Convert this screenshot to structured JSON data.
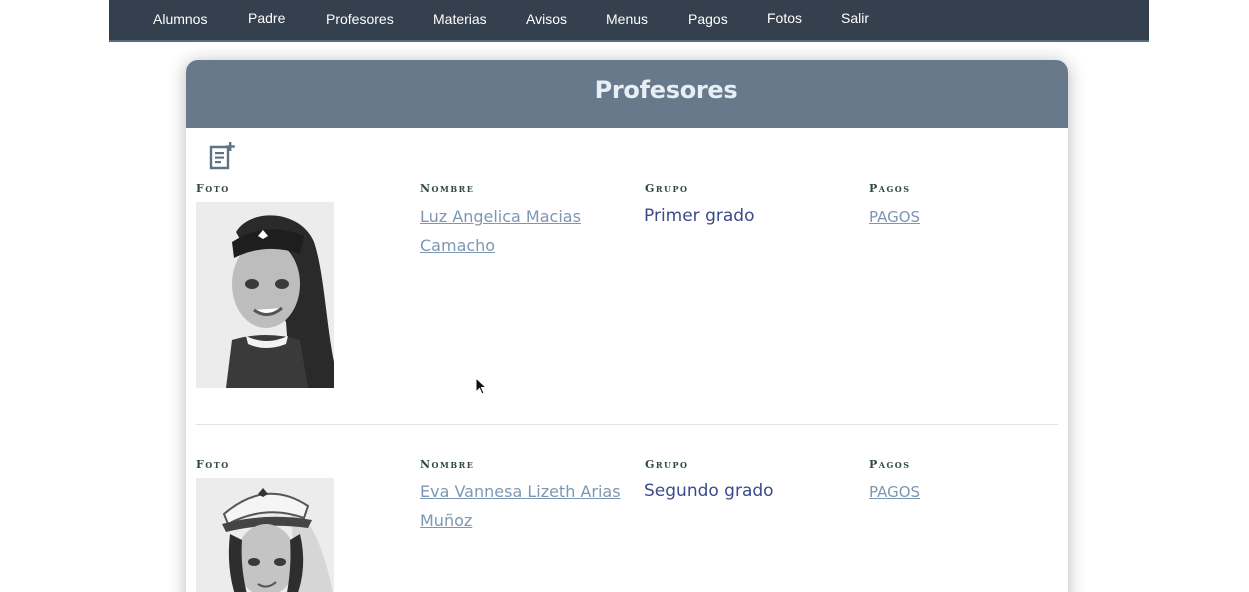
{
  "nav": {
    "items": [
      {
        "label": "Alumnos"
      },
      {
        "label": "Padre"
      },
      {
        "label": "Profesores"
      },
      {
        "label": "Materias"
      },
      {
        "label": "Avisos"
      },
      {
        "label": "Menus"
      },
      {
        "label": "Pagos"
      },
      {
        "label": "Fotos"
      },
      {
        "label": "Salir"
      }
    ]
  },
  "page": {
    "title": "Profesores",
    "add_icon": "add-note-icon"
  },
  "columns": {
    "foto": "Foto",
    "nombre": "Nombre",
    "grupo": "Grupo",
    "pagos": "Pagos"
  },
  "rows": [
    {
      "nombre_line1": "Luz Angelica Macias",
      "nombre_line2": "Camacho",
      "grupo": "Primer grado",
      "pagos": "PAGOS"
    },
    {
      "nombre_line1": "Eva Vannesa Lizeth Arias",
      "nombre_line2": "Muñoz",
      "grupo": "Segundo grado",
      "pagos": "PAGOS"
    }
  ],
  "colors": {
    "navbar": "#34404d",
    "header": "#67798a",
    "link": "#7d97b3",
    "grupo": "#3b4a8c"
  }
}
